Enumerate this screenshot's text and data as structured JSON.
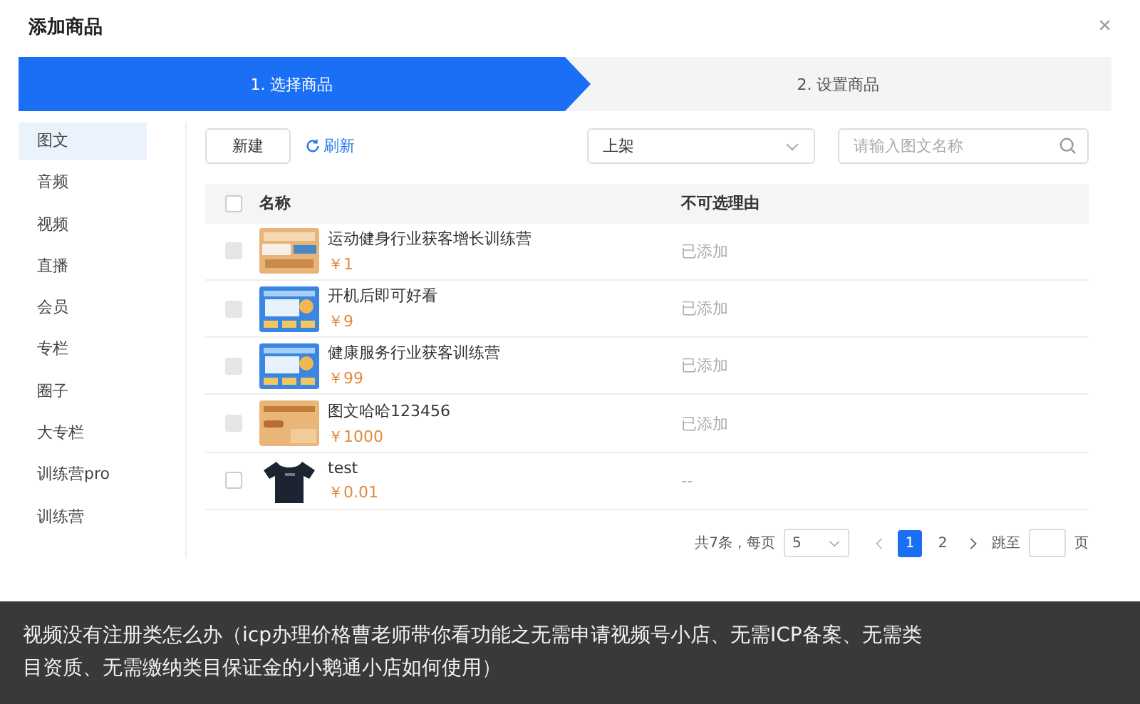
{
  "dialog": {
    "title": "添加商品",
    "close": "×"
  },
  "steps": [
    {
      "label": "1. 选择商品",
      "selected": true
    },
    {
      "label": "2. 设置商品",
      "selected": false
    }
  ],
  "sidebar": {
    "items": [
      {
        "label": "图文",
        "selected": true
      },
      {
        "label": "音频",
        "selected": false
      },
      {
        "label": "视频",
        "selected": false
      },
      {
        "label": "直播",
        "selected": false
      },
      {
        "label": "会员",
        "selected": false
      },
      {
        "label": "专栏",
        "selected": false
      },
      {
        "label": "圈子",
        "selected": false
      },
      {
        "label": "大专栏",
        "selected": false
      },
      {
        "label": "训练营pro",
        "selected": false
      },
      {
        "label": "训练营",
        "selected": false
      }
    ]
  },
  "toolbar": {
    "new_button": "新建",
    "refresh_link": "刷新",
    "status_select": "上架",
    "search": {
      "placeholder": "请输入图文名称"
    }
  },
  "table": {
    "select_all_checked": false,
    "columns": [
      "名称",
      "不可选理由"
    ],
    "rows": [
      {
        "name": "运动健身行业获客增长训练营",
        "price": "￥1",
        "reason": "已添加",
        "disabled": true
      },
      {
        "name": "开机后即可好看",
        "price": "￥9",
        "reason": "已添加",
        "disabled": true
      },
      {
        "name": "健康服务行业获客训练营",
        "price": "￥99",
        "reason": "已添加",
        "disabled": true
      },
      {
        "name": "图文哈哈123456",
        "price": "￥1000",
        "reason": "已添加",
        "disabled": true
      },
      {
        "name": "test",
        "price": "￥0.01",
        "reason": "--",
        "disabled": false
      }
    ]
  },
  "pagination": {
    "total": "共7条，每页",
    "page_size": "5",
    "pages": [
      {
        "label": "1",
        "selected": true
      },
      {
        "label": "2",
        "selected": false
      }
    ],
    "jump_label": "跳至",
    "jump_suffix": "页"
  },
  "caption": {
    "lines": [
      "视频没有注册类怎么办（icp办理价格曹老师带你看功能之无需申请视频号小店、无需ICP备案、无需类",
      "目资质、无需缴纳类目保证金的小鹅通小店如何使用）"
    ]
  }
}
